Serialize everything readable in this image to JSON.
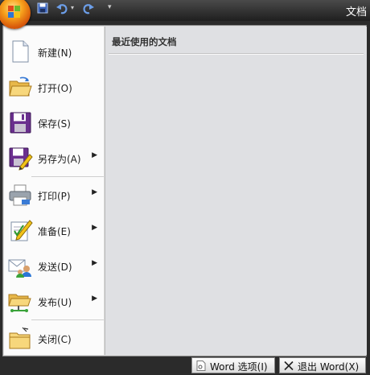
{
  "window": {
    "title": "文档"
  },
  "quick_access": {
    "customize_glyph": "▾",
    "undo_dropdown_glyph": "▾"
  },
  "office_menu": {
    "items": [
      {
        "label": "新建(N)",
        "icon": "new-document-icon",
        "submenu": false
      },
      {
        "label": "打开(O)",
        "icon": "open-folder-icon",
        "submenu": false
      },
      {
        "label": "保存(S)",
        "icon": "save-disk-icon",
        "submenu": false
      },
      {
        "label": "另存为(A)",
        "icon": "save-as-icon",
        "submenu": true
      },
      {
        "label": "打印(P)",
        "icon": "printer-icon",
        "submenu": true
      },
      {
        "label": "准备(E)",
        "icon": "prepare-icon",
        "submenu": true
      },
      {
        "label": "发送(D)",
        "icon": "send-icon",
        "submenu": true
      },
      {
        "label": "发布(U)",
        "icon": "publish-icon",
        "submenu": true
      },
      {
        "label": "关闭(C)",
        "icon": "close-folder-icon",
        "submenu": false
      }
    ],
    "submenu_glyph": "▶",
    "recent_documents": {
      "title": "最近使用的文档",
      "items": []
    }
  },
  "footer": {
    "word_options_label": "Word 选项(I)",
    "exit_word_label": "退出 Word(X)"
  },
  "colors": {
    "office_button": "#f7a21c",
    "menu_left_bg": "#fbfbfb",
    "menu_right_bg": "#dfe0e3",
    "titlebar": "#2b2b2b"
  }
}
